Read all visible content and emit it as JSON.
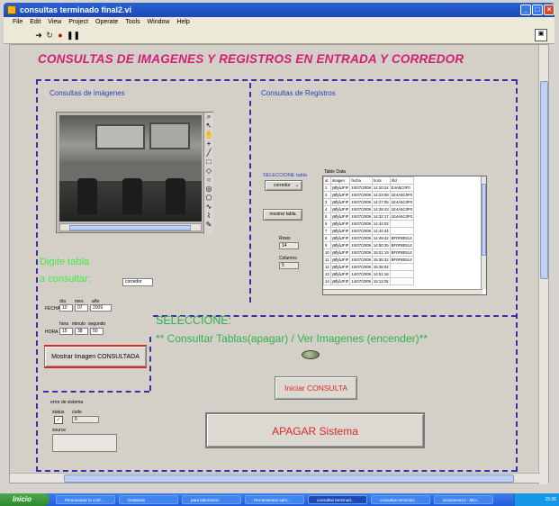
{
  "window": {
    "title": "consultas terminado final2.vi",
    "menu": [
      "File",
      "Edit",
      "View",
      "Project",
      "Operate",
      "Tools",
      "Window",
      "Help"
    ]
  },
  "main_title": "CONSULTAS DE IMAGENES Y REGISTROS  EN ENTRADA Y CORREDOR",
  "images_section": {
    "title": "Consultas de imágenes",
    "prompt_line1": "Digite tabla",
    "prompt_line2": "a consultar:",
    "table_value": "corredor",
    "date_labels": {
      "dia": "día",
      "mes": "mes",
      "anio": "año"
    },
    "fecha_label": "FECHA",
    "fecha": {
      "dia": "10",
      "mes": "07",
      "anio": "2009"
    },
    "time_labels": {
      "hora": "hora",
      "minuto": "minuto",
      "segundo": "segundo"
    },
    "hora_label": "HORA",
    "hora": {
      "hora": "15",
      "minuto": "38",
      "segundo": "50"
    },
    "show_button": "Mostrar Imagen CONSULTADA"
  },
  "registros_section": {
    "title": "Consultas de Registros",
    "select_label": "SELECCIONE tabla",
    "select_value": "corredor",
    "show_table_button": "mostrar tabla",
    "rows_label": "Rows",
    "rows_value": "14",
    "columns_label": "Columns",
    "columns_value": "5",
    "table_title": "Table Data",
    "table_headers": [
      "id",
      "imagen",
      "fecha",
      "hora",
      "rfid"
    ],
    "table_rows": [
      [
        "1",
        "ÿØÿàJFIF",
        "10/07/2009",
        "14:20:24",
        "E4A5C0F0"
      ],
      [
        "2",
        "ÿØÿàJFIF",
        "10/07/2009",
        "14:23:08",
        "1E4A5C0F0"
      ],
      [
        "3",
        "ÿØÿàJFIF",
        "10/07/2009",
        "14:27:05",
        "1E4A5C0F0"
      ],
      [
        "4",
        "ÿØÿàJFIF",
        "10/07/2009",
        "14:28:43",
        "1E4A5C0F0"
      ],
      [
        "5",
        "ÿØÿàJFIF",
        "10/07/2009",
        "14:32:17",
        "1E4A5C0F0"
      ],
      [
        "6",
        "ÿØÿàJFIF",
        "10/07/2009",
        "14:44:02",
        ""
      ],
      [
        "7",
        "ÿØÿàJFIF",
        "10/07/2009",
        "14:44:44",
        ""
      ],
      [
        "8",
        "ÿØÿàJFIF",
        "10/07/2009",
        "14:49:42",
        "BF0F8E514"
      ],
      [
        "9",
        "ÿØÿàJFIF",
        "10/07/2009",
        "14:50:25",
        "BF0F8E514"
      ],
      [
        "10",
        "ÿØÿàJFIF",
        "10/07/2009",
        "15:01:19",
        "BF0F8E514"
      ],
      [
        "11",
        "ÿØÿàJFIF",
        "10/07/2009",
        "15:35:32",
        "BF0F8E514"
      ],
      [
        "12",
        "ÿØÿàJFIF",
        "10/07/2009",
        "15:38:04",
        ""
      ],
      [
        "13",
        "ÿØÿàJFIF",
        "14/07/2009",
        "14:51:16",
        ""
      ],
      [
        "14",
        "ÿØÿàJFIF",
        "14/07/2009",
        "15:11:05",
        ""
      ]
    ]
  },
  "selection": {
    "title": "SELECCIONE:",
    "subtitle": "** Consultar Tablas(apagar) / Ver Imagenes (encender)**",
    "toggle_state": "off",
    "start_button": "Iniciar CONSULTA",
    "shutdown_button": "APAGAR  Sistema"
  },
  "error_cluster": {
    "title": "error de sistema",
    "status_label": "status",
    "code_label": "code",
    "code_value": "0",
    "source_label": "source",
    "status_check": "✓"
  },
  "taskbar": {
    "start_label": "Inicio",
    "tasks": [
      "Personalizar la conf...",
      "Database",
      "para laboratorio",
      "Herramientas adm...",
      "consultas terminad...",
      "consultas terminad...",
      "Documento1 - Micr..."
    ],
    "active_task": 4,
    "clock": "15:36"
  },
  "colors": {
    "title_magenta": "#d21e76",
    "section_blue": "#2a3fb8",
    "green_prompt": "#48e848",
    "green_select": "#2fb14e",
    "button_red": "#e0252a",
    "border_navy": "#3a2fa8"
  }
}
